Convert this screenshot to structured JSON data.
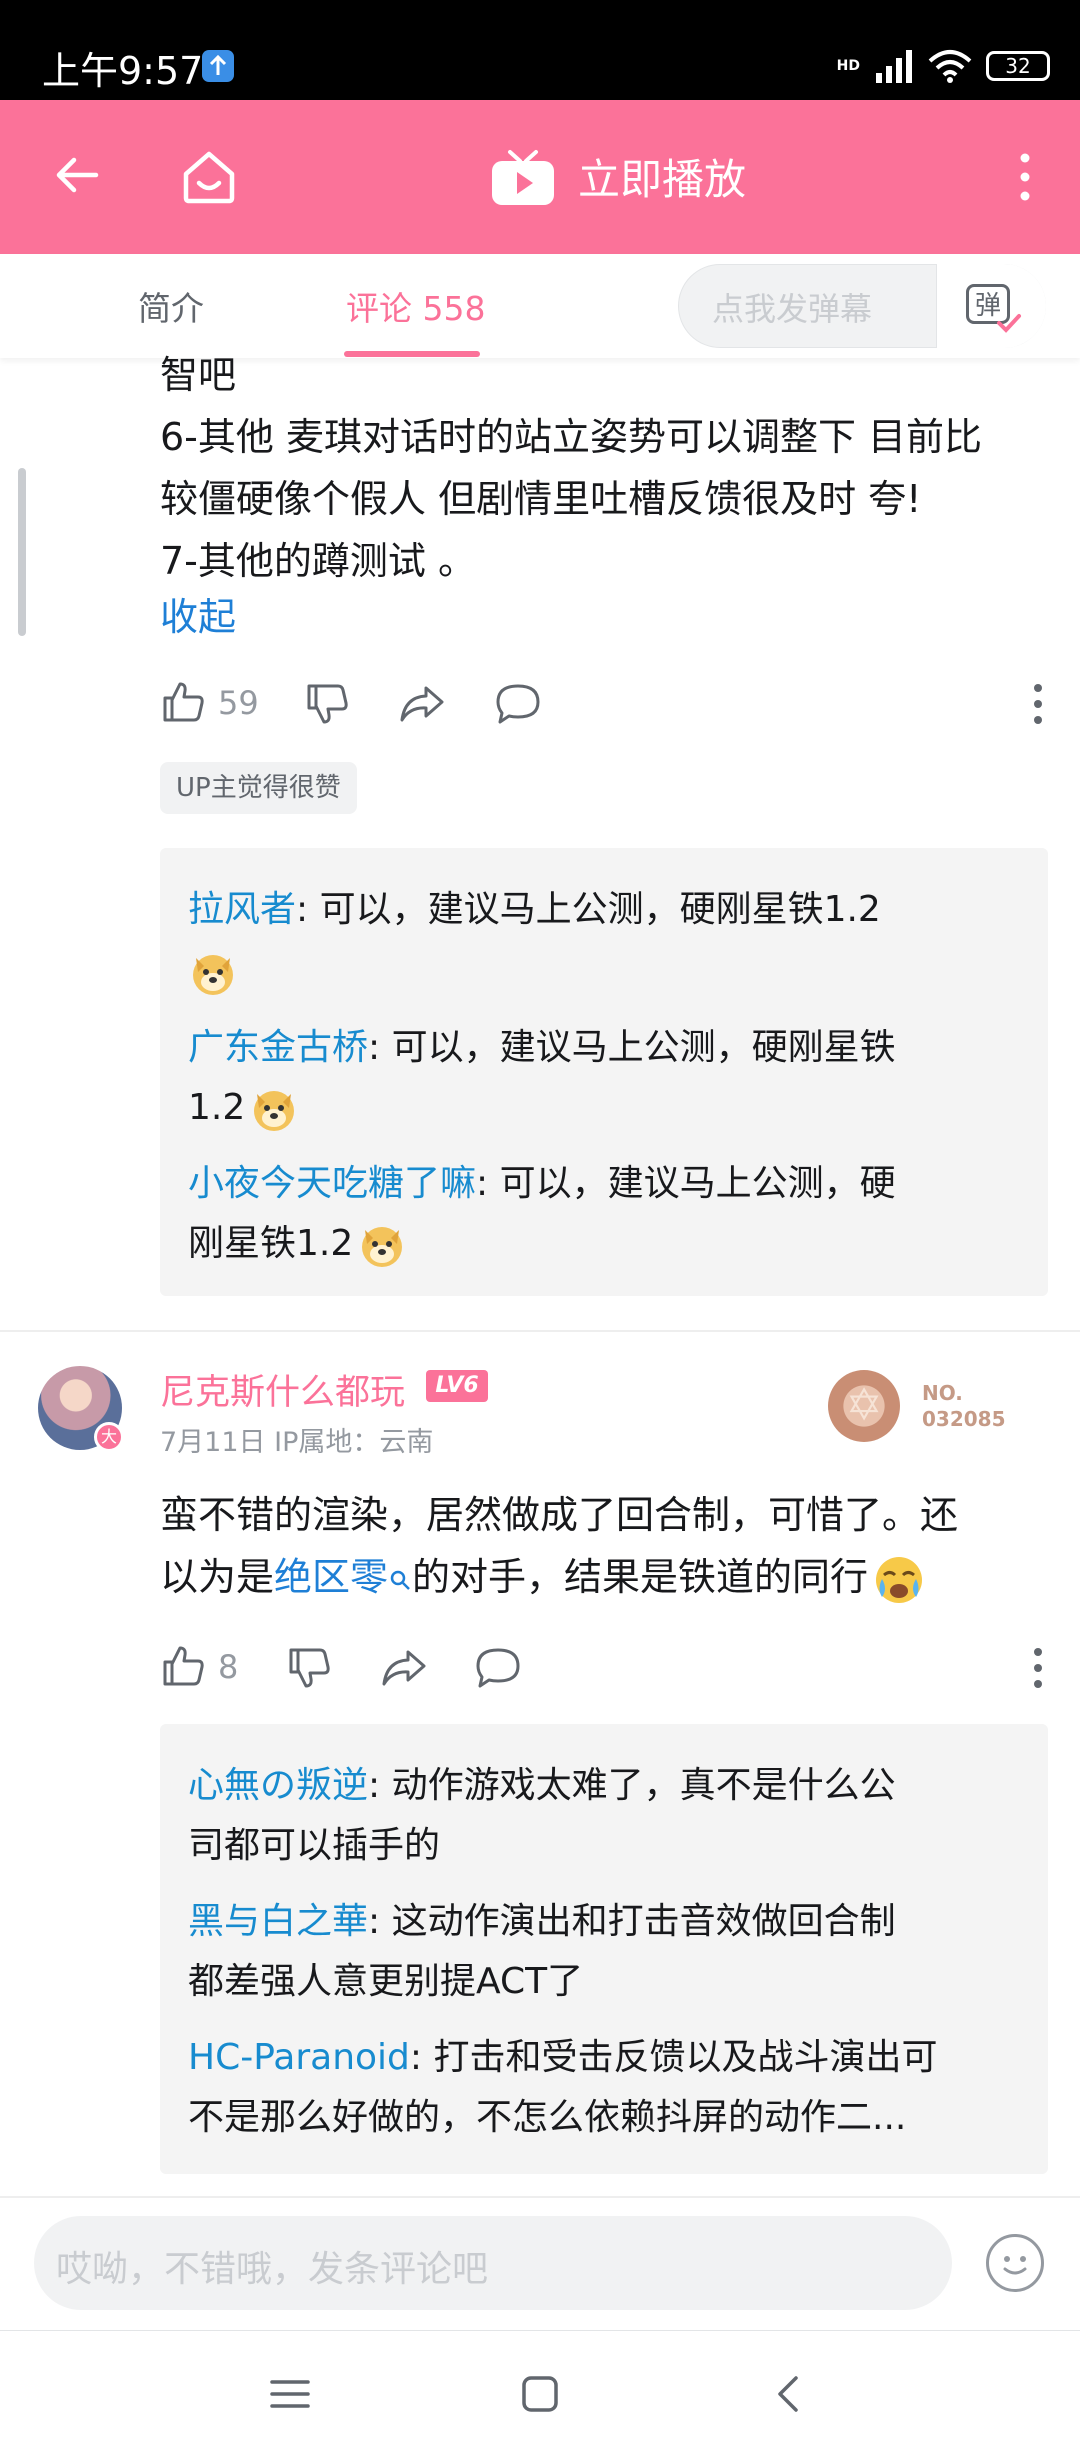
{
  "status_bar": {
    "time": "上午9:57",
    "network": "HD",
    "battery": "32"
  },
  "header": {
    "play_label": "立即播放"
  },
  "tabs": [
    {
      "label": "简介"
    },
    {
      "label": "评论 558"
    }
  ],
  "danmaku": {
    "placeholder": "点我发弹幕",
    "button_glyph": "弹"
  },
  "comment1": {
    "lines": [
      "智吧",
      "6-其他 麦琪对话时的站立姿势可以调整下 目前比",
      "较僵硬像个假人 但剧情里吐槽反馈很及时 夸!",
      "7-其他的蹲测试 。"
    ],
    "collapse": "收起",
    "likes": "59",
    "badge": "UP主觉得很赞",
    "replies": [
      {
        "name": "拉风者",
        "text": ": 可以，建议马上公测，硬刚星铁1.2",
        "wrap": ""
      },
      {
        "name": "广东金古桥",
        "text": ": 可以，建议马上公测，硬刚星铁",
        "wrap": "1.2"
      },
      {
        "name": "小夜今天吃糖了嘛",
        "text": ": 可以，建议马上公测，硬",
        "wrap": "刚星铁1.2"
      }
    ]
  },
  "comment2": {
    "username": "尼克斯什么都玩",
    "level": "LV6",
    "avatar_badge": "大",
    "meta": "7月11日  IP属地：云南",
    "medal_label": "NO.",
    "medal_number": "032085",
    "text_line1": "蛮不错的渲染，居然做成了回合制，可惜了。还",
    "text_prefix": "以为是",
    "text_link": "绝区零",
    "text_suffix": "的对手，结果是铁道的同行",
    "likes": "8",
    "replies": [
      {
        "name": "心無の叛逆",
        "text": ": 动作游戏太难了，真不是什么公",
        "wrap": "司都可以插手的"
      },
      {
        "name": "黑与白之華",
        "text": ": 这动作演出和打击音效做回合制",
        "wrap": "都差强人意更别提ACT了"
      },
      {
        "name": "HC-Paranoid",
        "text": ": 打击和受击反馈以及战斗演出可",
        "wrap": "不是那么好做的，不怎么依赖抖屏的动作二..."
      }
    ]
  },
  "input": {
    "placeholder": "哎呦，不错哦，发条评论吧"
  },
  "colors": {
    "accent": "#fb7299",
    "link": "#178bcf"
  }
}
